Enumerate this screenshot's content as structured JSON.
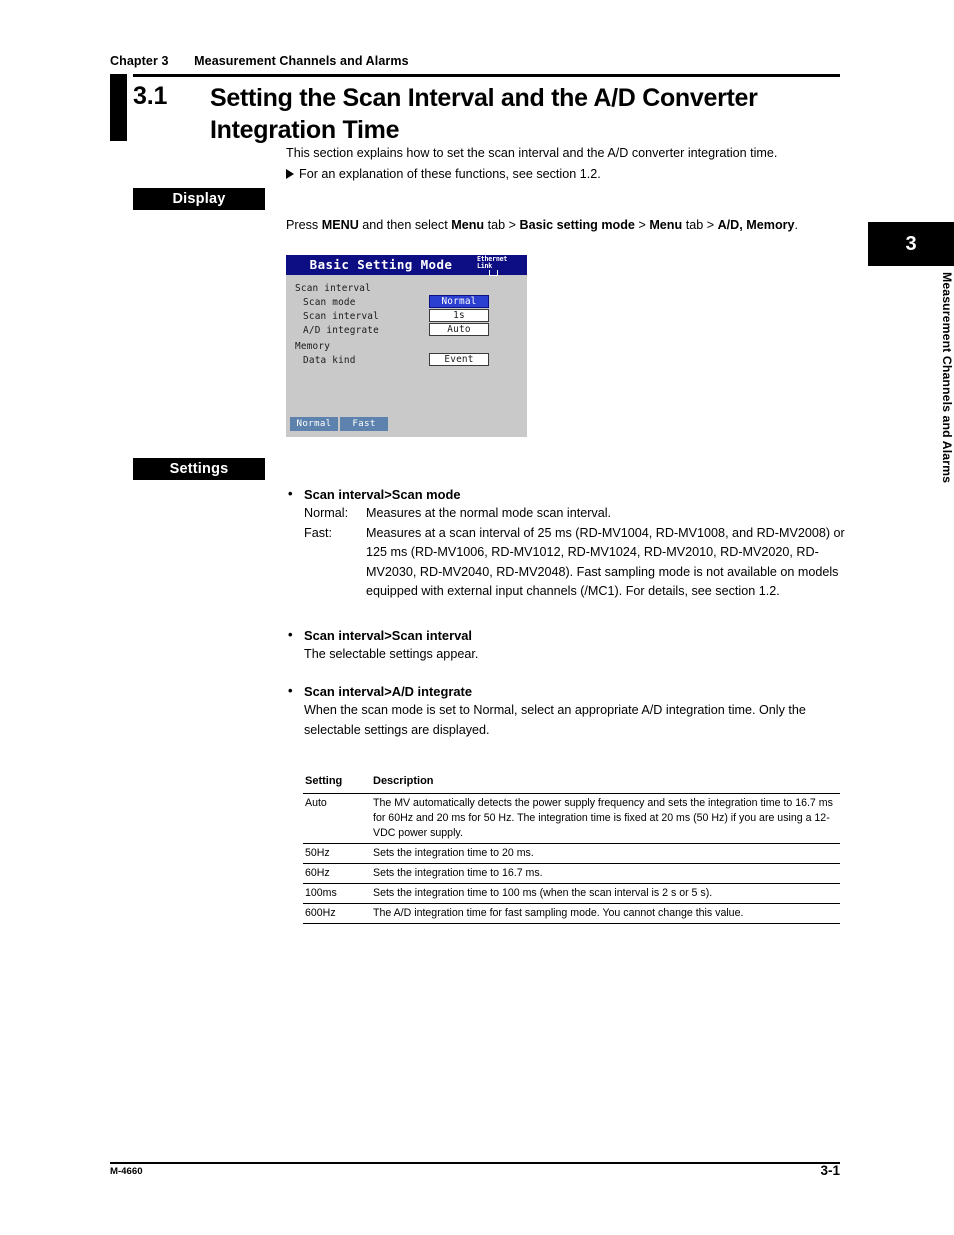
{
  "running_head": {
    "chapter": "Chapter 3",
    "title": "Measurement Channels and Alarms"
  },
  "section": {
    "number": "3.1",
    "title": "Setting the Scan Interval and the A/D Converter Integration Time",
    "intro": "This section explains how to set the scan interval and the A/D converter integration time.",
    "cross_reference": "For an explanation of these functions, see section 1.2."
  },
  "display": {
    "tab_label": "Display",
    "menu_path": {
      "p1": "Press ",
      "b1": "MENU",
      "p2": " and then select ",
      "b2": "Menu",
      "p3": " tab > ",
      "b3": "Basic setting mode",
      "p4": " > ",
      "b4": "Menu",
      "p5": " tab > ",
      "b5": "A/D, Memory",
      "p6": "."
    }
  },
  "lcd": {
    "title": "Basic Setting Mode",
    "ethernet_indicator": "Ethernet Link",
    "ethernet_line1": "Ethernet",
    "ethernet_line2": "Link",
    "group1_label": "Scan interval",
    "rows": [
      {
        "label": "Scan mode",
        "value": "Normal",
        "selected": true
      },
      {
        "label": "Scan interval",
        "value": "1s",
        "selected": false
      },
      {
        "label": "A/D integrate",
        "value": "Auto",
        "selected": false
      }
    ],
    "group2_label": "Memory",
    "row_data_kind": {
      "label": "Data kind",
      "value": "Event"
    },
    "tabs": [
      "Normal",
      "Fast"
    ],
    "colors": {
      "titlebar": "#0d0d84",
      "body": "#c9c9c9",
      "selected_value": "#2b3fd0",
      "tab": "#5d82ad"
    }
  },
  "settings": {
    "tab_label": "Settings",
    "items": [
      {
        "heading": "Scan interval>Scan mode",
        "definitions": [
          {
            "term": "Normal:",
            "body": "Measures at the normal mode scan interval."
          },
          {
            "term": "Fast:",
            "body": "Measures at a scan interval of 25 ms (RD-MV1004, RD-MV1008, and RD-MV2008) or 125 ms (RD-MV1006, RD-MV1012, RD-MV1024, RD-MV2010, RD-MV2020, RD-MV2030, RD-MV2040, RD-MV2048). Fast sampling mode is not available on models equipped with external input channels (/MC1). For details, see section 1.2."
          }
        ]
      },
      {
        "heading": "Scan interval>Scan interval",
        "body": "The selectable settings appear."
      },
      {
        "heading": "Scan interval>A/D integrate",
        "body": "When the scan mode is set to Normal, select an appropriate A/D integration time. Only the selectable settings are displayed."
      }
    ]
  },
  "table": {
    "headers": [
      "Setting",
      "Description"
    ],
    "rows": [
      {
        "setting": "Auto",
        "description": "The MV automatically detects the power supply frequency and sets the integration time to 16.7 ms for 60Hz and 20 ms for 50 Hz. The integration time is fixed at 20 ms (50 Hz) if you are using a 12-VDC power supply."
      },
      {
        "setting": "50Hz",
        "description": "Sets the integration time to 20 ms."
      },
      {
        "setting": "60Hz",
        "description": "Sets the integration time to 16.7 ms."
      },
      {
        "setting": "100ms",
        "description": "Sets the integration time to 100 ms (when the scan interval is 2 s or 5 s)."
      },
      {
        "setting": "600Hz",
        "description": "The A/D integration time for fast sampling mode. You cannot change this value."
      }
    ]
  },
  "chapter_thumb": {
    "number": "3",
    "label": "Measurement Channels and Alarms"
  },
  "footer": {
    "doc_id": "M-4660",
    "page": "3-1"
  }
}
